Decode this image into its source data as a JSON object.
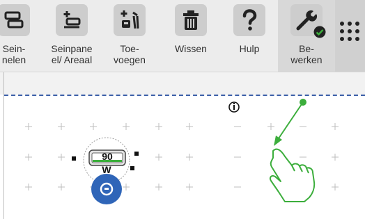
{
  "toolbar": {
    "items": [
      {
        "label": "Sein-\nnelen",
        "icon": "signal-panel-icon"
      },
      {
        "label": "Seinpane\nel/ Areaal",
        "icon": "add-panel-area-icon"
      },
      {
        "label": "Toe-\nvoegen",
        "icon": "add-element-icon"
      },
      {
        "label": "Wissen",
        "icon": "trash-icon"
      },
      {
        "label": "Hulp",
        "icon": "help-icon"
      },
      {
        "label": "Be-\nwerken",
        "icon": "wrench-icon"
      }
    ],
    "menu_icon": "grid-menu-icon"
  },
  "canvas": {
    "info_symbol": "ⓘ",
    "signal_value": "90",
    "signal_sub": "W",
    "hint_icon": "tap-hand-icon"
  },
  "colors": {
    "accent_green": "#3cae3c",
    "dash_blue": "#3b5fa8",
    "signal_blue": "#2f65b8"
  }
}
